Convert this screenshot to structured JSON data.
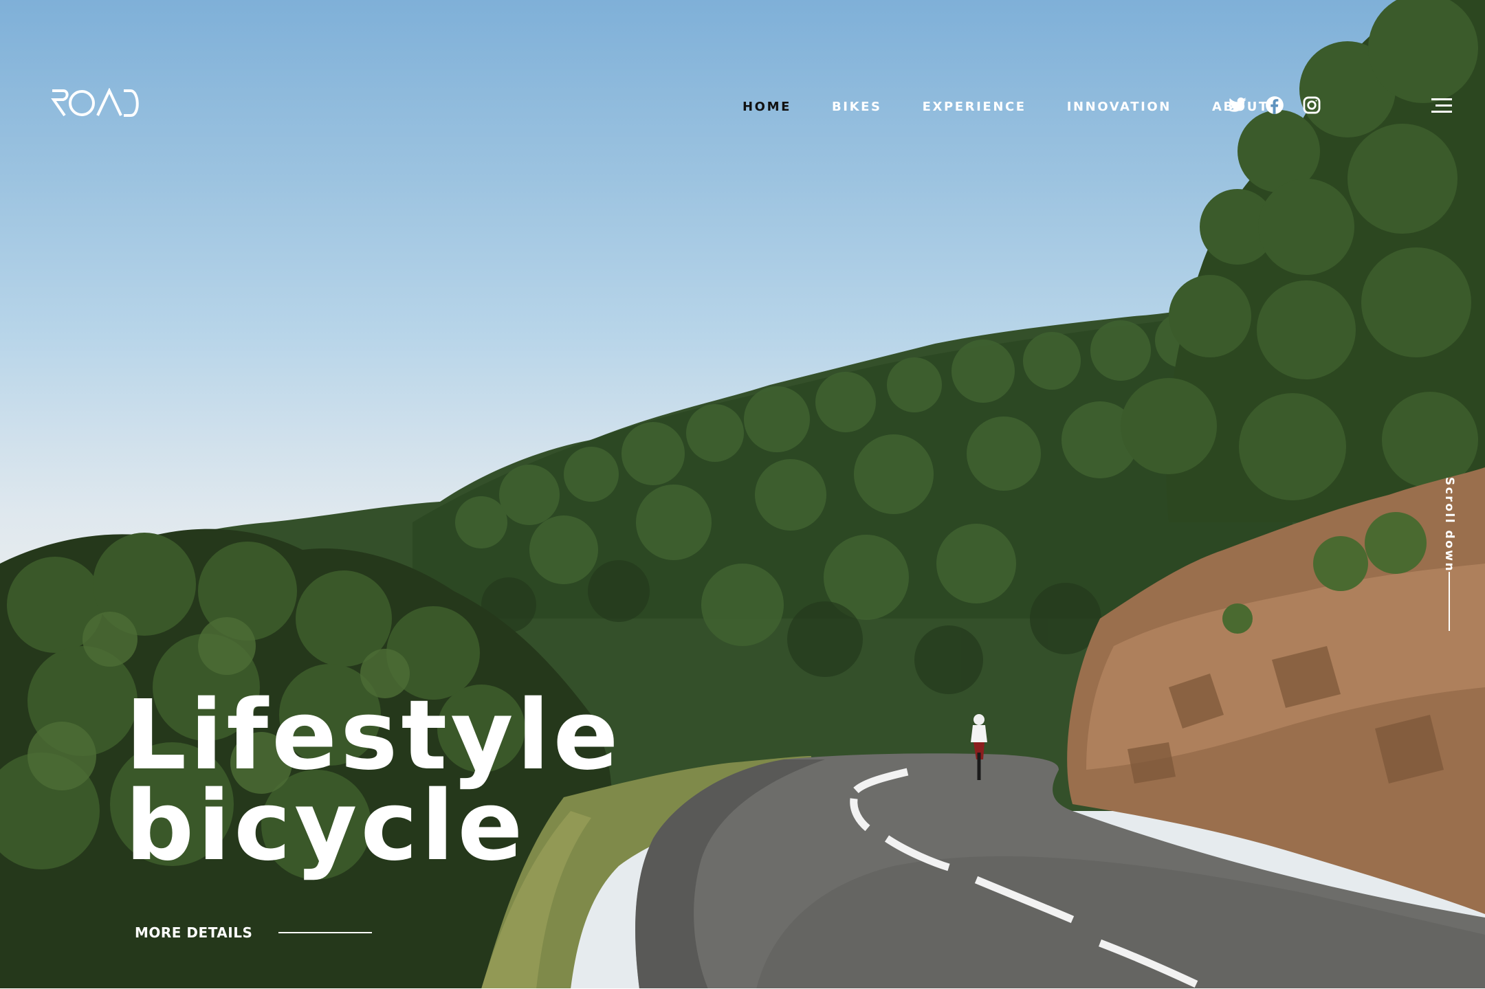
{
  "brand": {
    "logo_text": "ROAD",
    "logo_icon": "road-logo"
  },
  "nav": {
    "items": [
      {
        "label": "HOME",
        "active": true
      },
      {
        "label": "BIKES",
        "active": false
      },
      {
        "label": "EXPERIENCE",
        "active": false
      },
      {
        "label": "INNOVATION",
        "active": false
      },
      {
        "label": "ABOUT",
        "active": false
      }
    ]
  },
  "social": [
    {
      "icon": "twitter-icon"
    },
    {
      "icon": "facebook-icon"
    },
    {
      "icon": "instagram-icon"
    }
  ],
  "menu": {
    "icon": "hamburger-menu-icon"
  },
  "hero": {
    "headline_line1": "Lifestyle",
    "headline_line2": "bicycle",
    "cta_label": "MORE DETAILS",
    "scroll_label": "Scroll down",
    "background": "cyclist-on-mountain-road-photo"
  },
  "colors": {
    "nav_active": "#111111",
    "nav_text": "#ffffff",
    "sky_top": "#7fb0d8",
    "foliage": "#2f4a22",
    "rock": "#a57a55",
    "road": "#6b6b68"
  }
}
